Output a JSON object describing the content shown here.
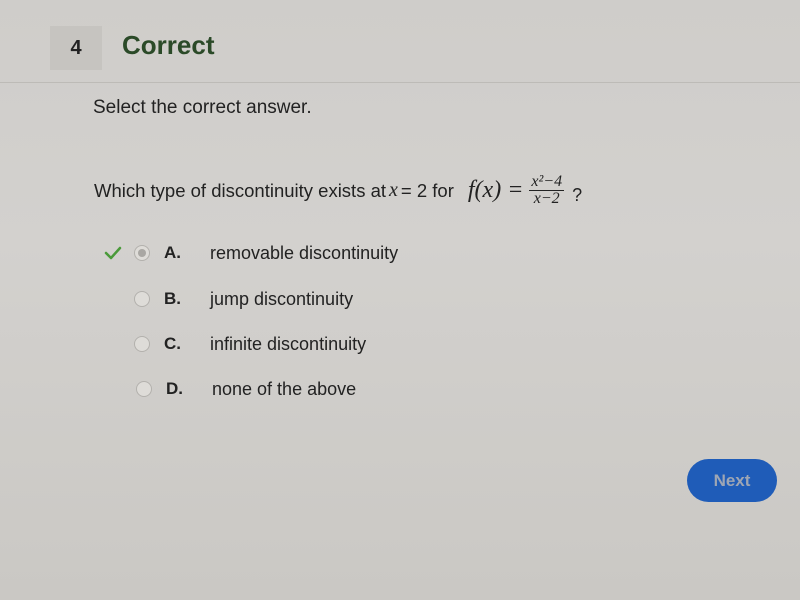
{
  "header": {
    "question_number": "4",
    "status": "Correct"
  },
  "instruction": "Select the correct answer.",
  "question": {
    "prefix": "Which type of discontinuity exists at",
    "variable": "x",
    "equals": "= 2 for",
    "formula": {
      "lhs": "f(x) =",
      "numerator": "x²−4",
      "denominator": "x−2"
    },
    "suffix": "?"
  },
  "options": [
    {
      "letter": "A.",
      "text": "removable discontinuity",
      "selected": true,
      "correct": true
    },
    {
      "letter": "B.",
      "text": "jump discontinuity",
      "selected": false,
      "correct": false
    },
    {
      "letter": "C.",
      "text": "infinite discontinuity",
      "selected": false,
      "correct": false
    },
    {
      "letter": "D.",
      "text": "none of the above",
      "selected": false,
      "correct": false
    }
  ],
  "next_button": {
    "label": "Next"
  },
  "colors": {
    "correct_green": "#2b4a28",
    "check_green": "#4a9a3a",
    "button_blue": "#1f5cb8"
  }
}
